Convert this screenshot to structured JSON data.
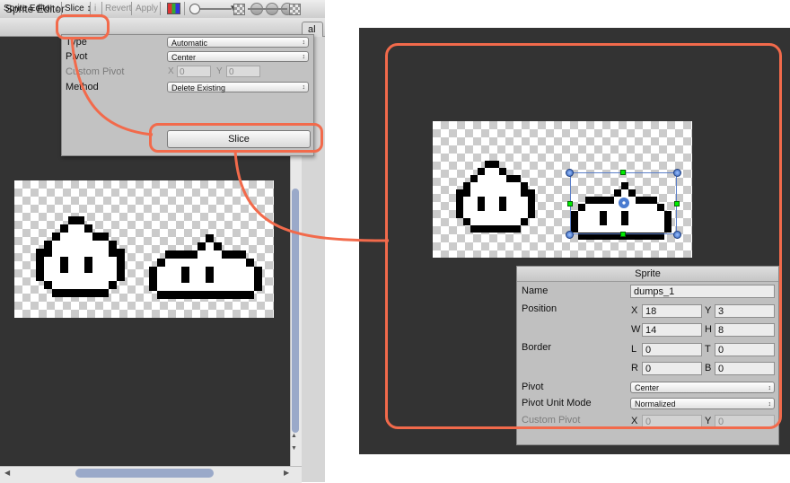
{
  "left_window": {
    "title": "Sprite Editor",
    "menu_icon": "list-menu-icon",
    "toolbar": {
      "sprite_editor_dropdown": "Sprite Editor ↕",
      "slice_dropdown": "Slice ↕",
      "info_label": "i",
      "revert": "Revert",
      "apply": "Apply",
      "partial_right_label": "al"
    },
    "slice_popup": {
      "type_label": "Type",
      "type_value": "Automatic",
      "pivot_label": "Pivot",
      "pivot_value": "Center",
      "custom_pivot_label": "Custom Pivot",
      "x_label": "X",
      "x_value": "0",
      "y_label": "Y",
      "y_value": "0",
      "method_label": "Method",
      "method_value": "Delete Existing",
      "slice_button": "Slice"
    }
  },
  "inspector": {
    "header": "Sprite",
    "name_label": "Name",
    "name_value": "dumps_1",
    "position_label": "Position",
    "x_label": "X",
    "x_value": "18",
    "y_label": "Y",
    "y_value": "3",
    "w_label": "W",
    "w_value": "14",
    "h_label": "H",
    "h_value": "8",
    "border_label": "Border",
    "l_label": "L",
    "l_value": "0",
    "t_label": "T",
    "t_value": "0",
    "r_label": "R",
    "r_value": "0",
    "b_label": "B",
    "b_value": "0",
    "pivot_label": "Pivot",
    "pivot_value": "Center",
    "pivot_unit_mode_label": "Pivot Unit Mode",
    "pivot_unit_mode_value": "Normalized",
    "custom_pivot_label": "Custom Pivot",
    "cx_label": "X",
    "cx_value": "0",
    "cy_label": "Y",
    "cy_value": "0"
  },
  "icons": {
    "dropdown_arrow": "↕",
    "scroll_up": "▲",
    "scroll_down": "▼",
    "scroll_left": "◀",
    "scroll_right": "▶",
    "menu": "▾≡"
  },
  "colors": {
    "callout": "#f26a4b",
    "canvas_bg": "#333333",
    "selection": "#5b7fc9",
    "pivot_handle": "#4a7bd0",
    "green_handle": "#00ee00"
  }
}
